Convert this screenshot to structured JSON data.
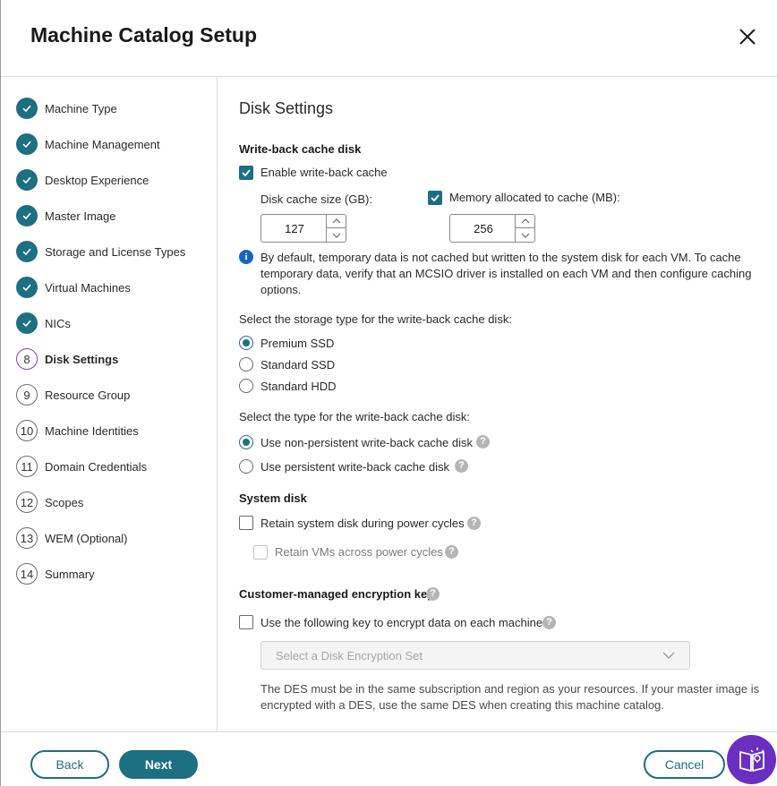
{
  "dialog": {
    "title": "Machine Catalog Setup"
  },
  "steps": [
    {
      "label": "Machine Type",
      "state": "done"
    },
    {
      "label": "Machine Management",
      "state": "done"
    },
    {
      "label": "Desktop Experience",
      "state": "done"
    },
    {
      "label": "Master Image",
      "state": "done"
    },
    {
      "label": "Storage and License Types",
      "state": "done"
    },
    {
      "label": "Virtual Machines",
      "state": "done"
    },
    {
      "label": "NICs",
      "state": "done"
    },
    {
      "label": "Disk Settings",
      "number": "8",
      "state": "current"
    },
    {
      "label": "Resource Group",
      "number": "9",
      "state": "pending"
    },
    {
      "label": "Machine Identities",
      "number": "10",
      "state": "pending"
    },
    {
      "label": "Domain Credentials",
      "number": "11",
      "state": "pending"
    },
    {
      "label": "Scopes",
      "number": "12",
      "state": "pending"
    },
    {
      "label": "WEM (Optional)",
      "number": "13",
      "state": "pending"
    },
    {
      "label": "Summary",
      "number": "14",
      "state": "pending"
    }
  ],
  "main": {
    "heading": "Disk Settings",
    "wbc": {
      "section_label": "Write-back cache disk",
      "enable_label": "Enable write-back cache",
      "enable_checked": true,
      "disk_cache_label": "Disk cache size (GB):",
      "disk_cache_value": "127",
      "memory_label": "Memory allocated to cache (MB):",
      "memory_checked": true,
      "memory_value": "256",
      "info_line1": "By default, temporary data is not cached but written to the system disk for each VM. To cache",
      "info_line2": "temporary data, verify that an MCSIO driver is installed on each VM and then configure caching",
      "info_line3": "options."
    },
    "storage_type": {
      "prompt": "Select the storage type for the write-back cache disk:",
      "options": [
        "Premium SSD",
        "Standard SSD",
        "Standard HDD"
      ],
      "selected": "Premium SSD"
    },
    "cache_type": {
      "prompt": "Select the type for the write-back cache disk:",
      "options": [
        "Use non-persistent write-back cache disk",
        "Use persistent write-back cache disk"
      ],
      "selected": "Use non-persistent write-back cache disk"
    },
    "system_disk": {
      "section_label": "System disk",
      "retain_label": "Retain system disk during power cycles",
      "retain_vms_label": "Retain VMs across power cycles"
    },
    "encryption": {
      "section_label": "Customer-managed encryption key",
      "use_key_label": "Use the following key to encrypt data on each machine",
      "select_placeholder": "Select a Disk Encryption Set",
      "note_line1": "The DES must be in the same subscription and region as your resources. If your master image is",
      "note_line2": "encrypted with a DES, use the same DES when creating this machine catalog."
    },
    "help_glyph": "?",
    "info_glyph": "i"
  },
  "footer": {
    "back": "Back",
    "next": "Next",
    "cancel": "Cancel"
  },
  "colors": {
    "accent": "#1d6f82",
    "current_step": "#7b3fbf",
    "info": "#1565c0",
    "fab": "#6a2fc2"
  },
  "icons": {
    "close": "close-icon",
    "check": "check-icon",
    "info": "info-icon",
    "help": "help-icon",
    "chevron": "chevron-down-icon",
    "fab": "guide-book-icon"
  }
}
